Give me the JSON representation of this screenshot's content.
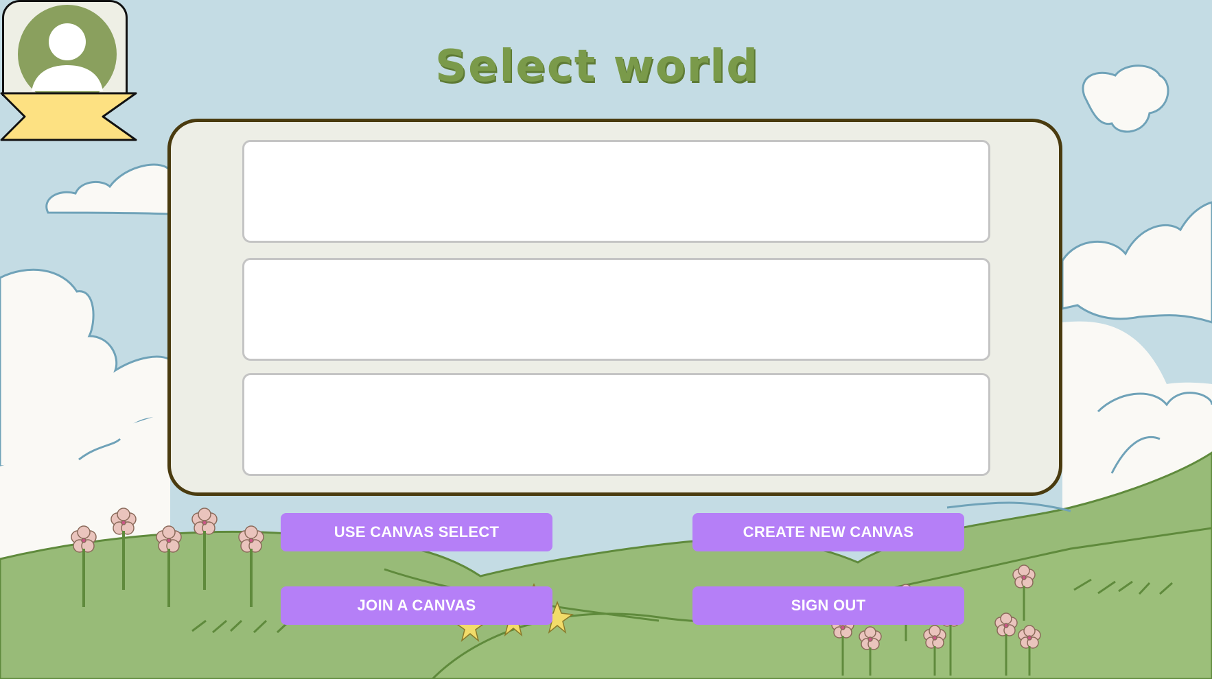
{
  "page": {
    "title": "Select world"
  },
  "world_list": {
    "slots": [
      {
        "label": ""
      },
      {
        "label": ""
      },
      {
        "label": ""
      }
    ]
  },
  "actions": {
    "use_canvas_select": "USE CANVAS SELECT",
    "create_new_canvas": "CREATE NEW CANVAS",
    "join_a_canvas": "JOIN A CANVAS",
    "sign_out": "SIGN OUT"
  },
  "colors": {
    "sky": "#c4dce4",
    "cloud": "#faf9f5",
    "cloud_outline": "#6fa2b8",
    "hill": "#98bb78",
    "hill_outline": "#5f8a3c",
    "title": "#7a9a4a",
    "panel_fill": "#edeee6",
    "panel_border": "#4a3b0f",
    "button": "#b57ff7",
    "avatar": "#8aa05e",
    "ribbon": "#fde182"
  },
  "icons": {
    "avatar": "user-avatar-icon",
    "ribbon": "name-ribbon-icon"
  }
}
